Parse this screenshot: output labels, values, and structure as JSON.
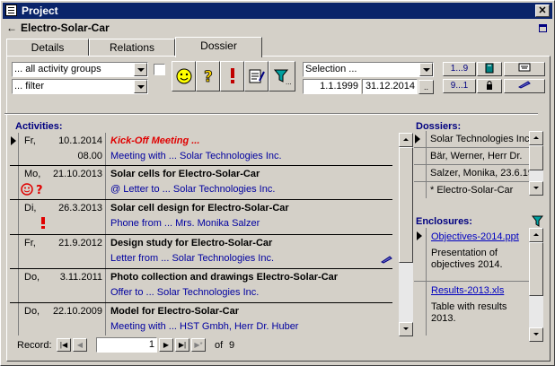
{
  "window": {
    "title": "Project",
    "close": "✕"
  },
  "record_title": "Electro-Solar-Car",
  "tabs": [
    {
      "label": "Details"
    },
    {
      "label": "Relations"
    },
    {
      "label": "Dossier"
    }
  ],
  "filters": {
    "activity_groups": "... all activity groups",
    "filter": "... filter",
    "selection": "Selection ...",
    "date_from": "1.1.1999",
    "date_to": "31.12.2014",
    "more": "..",
    "sort_asc": "1...9",
    "sort_desc": "9...1"
  },
  "activities_label": "Activities:",
  "activities": [
    {
      "day": "Fr,",
      "date": "10.1.2014",
      "time": "08.00",
      "title": "Kick-Off Meeting ...",
      "subtitle": "Meeting with ... Solar Technologies Inc."
    },
    {
      "day": "Mo,",
      "date": "21.10.2013",
      "time": "",
      "title": "Solar cells for Electro-Solar-Car",
      "subtitle": "@ Letter to ... Solar Technologies Inc."
    },
    {
      "day": "Di,",
      "date": "26.3.2013",
      "time": "",
      "title": "Solar cell design for Electro-Solar-Car",
      "subtitle": "Phone from ... Mrs. Monika Salzer"
    },
    {
      "day": "Fr,",
      "date": "21.9.2012",
      "time": "",
      "title": "Design study for Electro-Solar-Car",
      "subtitle": "Letter from ... Solar Technologies Inc."
    },
    {
      "day": "Do,",
      "date": "3.11.2011",
      "time": "",
      "title": "Photo collection and drawings Electro-Solar-Car",
      "subtitle": "Offer to ... Solar Technologies Inc."
    },
    {
      "day": "Do,",
      "date": "22.10.2009",
      "time": "",
      "title": "Model for Electro-Solar-Car",
      "subtitle": "Meeting with ... HST Gmbh, Herr Dr. Huber"
    }
  ],
  "navigation": {
    "label": "Record:",
    "current": "1",
    "of": "of",
    "total": "9"
  },
  "dossiers_label": "Dossiers:",
  "dossiers": [
    {
      "name": "Solar Technologies Inc"
    },
    {
      "name": "Bär, Werner, Herr Dr."
    },
    {
      "name": "Salzer, Monika, 23.6.19"
    },
    {
      "name": "* Electro-Solar-Car"
    }
  ],
  "enclosures_label": "Enclosures:",
  "enclosures": [
    {
      "file": "Objectives-2014.ppt",
      "desc": "Presentation of objectives 2014."
    },
    {
      "file": "Results-2013.xls",
      "desc": "Table with results 2013."
    }
  ]
}
